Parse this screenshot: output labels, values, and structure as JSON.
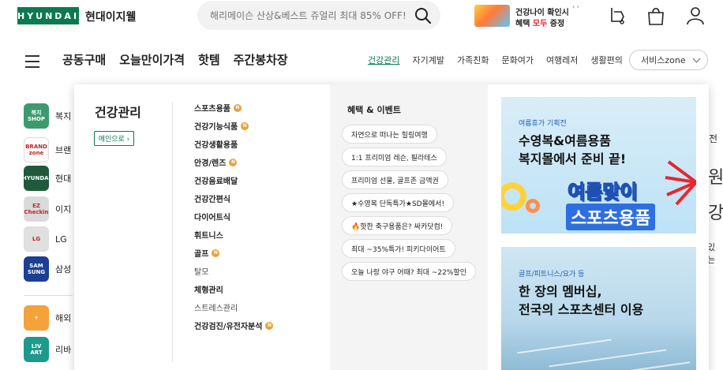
{
  "header": {
    "logo_text": "HYUNDAI",
    "brand_name": "현대이지웰",
    "search_placeholder": "해리메이슨 산상&베스트 쥬얼리 최대 85% OFF!",
    "promo": {
      "line1": "건강나이 확인시",
      "line2_pre": "혜택 ",
      "line2_highlight": "모두",
      "line2_post": " 증정",
      "arrows": "‹ ›"
    },
    "icons": [
      "search-icon",
      "recent-view-icon",
      "shopping-bag-icon",
      "user-icon"
    ]
  },
  "nav": {
    "main": [
      "공동구매",
      "오늘만이가격",
      "핫템",
      "주간봉차장"
    ],
    "sub": [
      "건강관리",
      "자기계발",
      "가족친화",
      "문화여가",
      "여행레저",
      "생활편의"
    ],
    "active_sub": "건강관리",
    "zone_label": "서비스zone"
  },
  "left_list": [
    {
      "icon_text": "복지\nSHOP",
      "label": "복지",
      "bg": "#3c9a6e"
    },
    {
      "icon_text": "BRAND\nzone",
      "label": "브랜",
      "bg": "#ffffff"
    },
    {
      "icon_text": "HYUNDAI",
      "label": "현대",
      "bg": "#1f5a3e"
    },
    {
      "icon_text": "EZ\nCheckin",
      "label": "이지",
      "bg": "#dadada"
    },
    {
      "icon_text": "LG",
      "label": "LG",
      "bg": "#e0e0e0"
    },
    {
      "icon_text": "SAM\nSUNG",
      "label": "삼성",
      "bg": "#1c3f94"
    },
    {
      "icon_text": "✈",
      "label": "해외",
      "bg": "#f4a23a"
    },
    {
      "icon_text": "LIV\nART",
      "label": "리바",
      "bg": "#1d9a8c"
    }
  ],
  "right_fragments": {
    "top": "전",
    "big1": "원",
    "big2": "강",
    "small": "있는"
  },
  "mega": {
    "title": "건강관리",
    "main_button": "메인으로 ›",
    "categories": [
      {
        "label": "스포츠용품",
        "badge": "N",
        "bold": true
      },
      {
        "label": "건강기능식품",
        "badge": "N",
        "bold": true
      },
      {
        "label": "건강생활용품",
        "badge": "",
        "bold": true
      },
      {
        "label": "안경/렌즈",
        "badge": "N",
        "bold": true
      },
      {
        "label": "건강음료배달",
        "badge": "",
        "bold": true
      },
      {
        "label": "건강간편식",
        "badge": "",
        "bold": true
      },
      {
        "label": "다이어트식",
        "badge": "",
        "bold": true
      },
      {
        "label": "휘트니스",
        "badge": "",
        "bold": true
      },
      {
        "label": "골프",
        "badge": "N",
        "bold": true
      },
      {
        "label": "탈모",
        "badge": "",
        "bold": false
      },
      {
        "label": "체형관리",
        "badge": "",
        "bold": true
      },
      {
        "label": "스트레스관리",
        "badge": "",
        "bold": false
      },
      {
        "label": "건강검진/유전자분석",
        "badge": "N",
        "bold": true
      }
    ],
    "events_title": "혜택 & 이벤트",
    "events": [
      "자연으로 떠나는 힐링여행",
      "1:1 프리미엄 레슨, 필라테스",
      "프리미엄 선물, 골프존 금액권",
      "★수영복 단독특가★SD몰에서!",
      "🔥핫한 축구용품은? 싸카닷컴!",
      "최대 ~35%특가! 피키다이어트",
      "오늘 나랑 야구 어때? 최대 ~22%할인"
    ],
    "banner1": {
      "tag": "여름휴가 기획전",
      "line1": "수영복&여름용품",
      "line2": "복지몰에서 준비 끝!",
      "art1": "여름맞이",
      "art2": "스포츠용품"
    },
    "banner2": {
      "tag": "골프/피트니스/요가 등",
      "line1": "한 장의 멤버십,",
      "line2": "전국의 스포츠센터 이용"
    }
  },
  "colors": {
    "brand_green": "#0b7a52",
    "badge_orange": "#e8a13a",
    "highlight_red": "#e8262d"
  }
}
